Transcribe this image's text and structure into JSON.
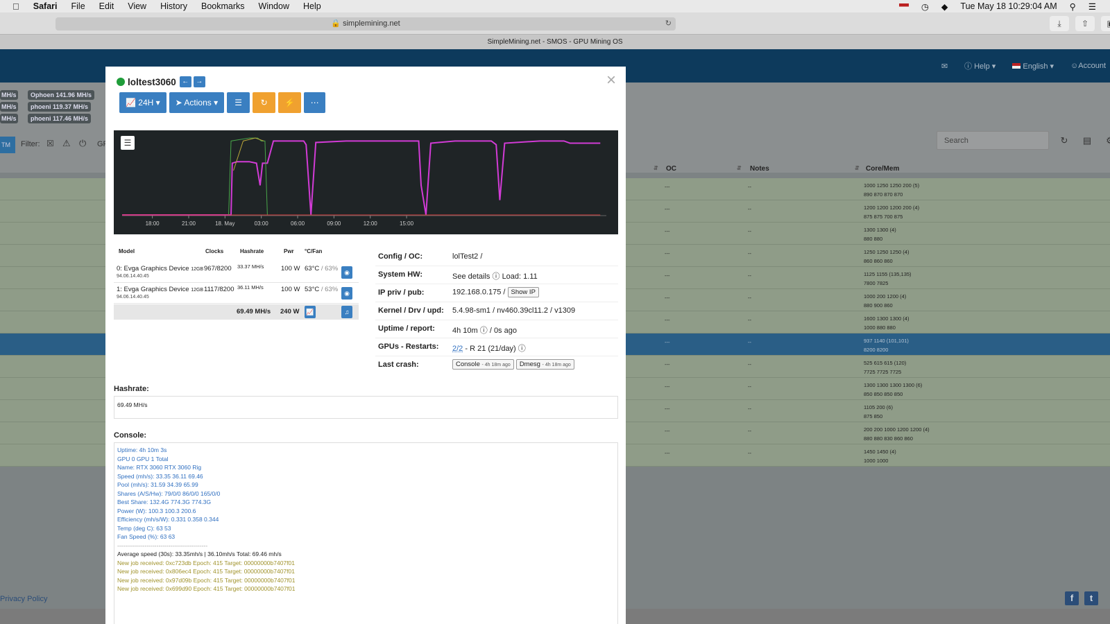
{
  "menubar": {
    "app": "Safari",
    "items": [
      "File",
      "Edit",
      "View",
      "History",
      "Bookmarks",
      "Window",
      "Help"
    ],
    "clock": "Tue May 18  10:29:04 AM"
  },
  "browser": {
    "url": "simplemining.net",
    "tab_title": "SimpleMining.net - SMOS - GPU Mining OS"
  },
  "navbar": {
    "help": "Help",
    "language": "English",
    "account": "Account"
  },
  "background": {
    "coins": [
      "Ophoen 141.96 MH/s",
      "phoeni 119.37 MH/s",
      "phoeni 117.46 MH/s"
    ],
    "left_stubs": [
      "MH/s",
      "MH/s",
      "MH/s"
    ],
    "filter_label": "Filter:",
    "filter_tag": "TM",
    "filter_extra": "GP",
    "search_placeholder": "Search",
    "headers": {
      "oc": "OC",
      "notes": "Notes",
      "core": "Core/Mem"
    },
    "rows": [
      {
        "oc": "---",
        "notes": "--",
        "core1": "1000 1250 1250 200 (5)",
        "core2": "890 870 870 870"
      },
      {
        "oc": "---",
        "notes": "--",
        "core1": "1200 1200 1200 200 (4)",
        "core2": "875 875 700 875"
      },
      {
        "oc": "---",
        "notes": "--",
        "core1": "1300 1300 (4)",
        "core2": "880 880"
      },
      {
        "oc": "---",
        "notes": "--",
        "core1": "1250 1250 1250 (4)",
        "core2": "860 860 860"
      },
      {
        "oc": "---",
        "notes": "--",
        "core1": "1125 1155 (135,135)",
        "core2": "7800 7825"
      },
      {
        "oc": "---",
        "notes": "--",
        "core1": "1000 200 1200 (4)",
        "core2": "880 900 860"
      },
      {
        "oc": "---",
        "notes": "--",
        "core1": "1600 1300 1300 (4)",
        "core2": "1000 880 880"
      },
      {
        "oc": "---",
        "notes": "--",
        "core1": "937 1140 (101,101)",
        "core2": "8200 8200"
      },
      {
        "oc": "---",
        "notes": "--",
        "core1": "525 615 615 (120)",
        "core2": "7725 7725 7725"
      },
      {
        "oc": "---",
        "notes": "--",
        "core1": "1300 1300 1300 1300 (6)",
        "core2": "850 850 850 850"
      },
      {
        "oc": "---",
        "notes": "--",
        "core1": "1105 200 (6)",
        "core2": "875 850"
      },
      {
        "oc": "---",
        "notes": "--",
        "core1": "200 200 1000 1200 1200 (4)",
        "core2": "880 880 830 860 860"
      },
      {
        "oc": "---",
        "notes": "--",
        "core1": "1450 1450 (4)",
        "core2": "1000 1000"
      }
    ],
    "privacy": "Privacy Policy"
  },
  "modal": {
    "rig_name": "loltest3060",
    "buttons": {
      "period": "24H",
      "actions": "Actions"
    },
    "chart_data": {
      "type": "line",
      "x_ticks": [
        "18:00",
        "21:00",
        "18. May",
        "03:00",
        "06:00",
        "09:00",
        "12:00",
        "15:00"
      ],
      "series": [
        {
          "color": "#d23bd6",
          "points": [
            [
              16.5,
              0
            ],
            [
              19,
              0
            ],
            [
              21,
              0
            ],
            [
              23,
              0
            ],
            [
              25.5,
              0
            ],
            [
              25.6,
              70
            ],
            [
              26,
              72
            ],
            [
              27,
              72
            ],
            [
              27.6,
              70
            ],
            [
              27.9,
              40
            ],
            [
              28.1,
              70
            ],
            [
              28.5,
              70
            ],
            [
              29,
              100
            ],
            [
              31.5,
              100
            ],
            [
              31.7,
              95
            ],
            [
              32.1,
              0
            ],
            [
              32.5,
              98
            ],
            [
              35,
              100
            ],
            [
              38,
              100
            ],
            [
              41,
              100
            ],
            [
              41.2,
              40
            ],
            [
              41.6,
              0
            ],
            [
              42,
              97
            ],
            [
              44,
              100
            ],
            [
              47,
              100
            ],
            [
              47.4,
              95
            ],
            [
              47.7,
              20
            ],
            [
              48.1,
              97
            ],
            [
              51,
              100
            ],
            [
              53,
              100
            ],
            [
              53.5,
              97
            ],
            [
              56,
              97
            ]
          ]
        },
        {
          "color": "#49a64a",
          "points": [
            [
              25.3,
              0
            ],
            [
              25.5,
              100
            ],
            [
              27,
              104
            ],
            [
              27.7,
              104
            ],
            [
              28,
              100
            ],
            [
              28.3,
              100
            ],
            [
              28.5,
              0
            ]
          ]
        },
        {
          "color": "#b9a63a",
          "points": [
            [
              25.7,
              60
            ],
            [
              26.5,
              100
            ],
            [
              27.5,
              104
            ],
            [
              28.2,
              100
            ]
          ]
        },
        {
          "color": "#d23b3b",
          "points": [
            [
              16.5,
              0
            ],
            [
              56,
              0
            ]
          ]
        }
      ],
      "ylim": [
        0,
        105
      ],
      "xlim": [
        16.5,
        56.5
      ]
    },
    "gpu_table": {
      "headers": {
        "model": "Model",
        "clocks": "Clocks",
        "hashrate": "Hashrate",
        "pwr": "Pwr",
        "temp": "°C/Fan"
      },
      "rows": [
        {
          "model": "0: Evga Graphics Device",
          "mem": "12GB",
          "ver": "94.06.14.40.45",
          "clocks": "967/8200",
          "hashrate": "33.37 MH/s",
          "pwr": "100 W",
          "temp": "63°C",
          "fan": "/ 63%"
        },
        {
          "model": "1: Evga Graphics Device",
          "mem": "12GB",
          "ver": "94.06.14.40.45",
          "clocks": "1117/8200",
          "hashrate": "36.11 MH/s",
          "pwr": "100 W",
          "temp": "53°C",
          "fan": "/ 63%"
        }
      ],
      "total_hashrate": "69.49 MH/s",
      "total_pwr": "240 W"
    },
    "info": {
      "config_label": "Config / OC:",
      "config_val": "lolTest2 /",
      "hw_label": "System HW:",
      "hw_link": "See details",
      "hw_load": "Load: 1.11",
      "ip_label": "IP priv / pub:",
      "ip_val": "192.168.0.175 /",
      "show_ip": "Show IP",
      "kernel_label": "Kernel / Drv / upd:",
      "kernel_val": "5.4.98-sm1 / nv460.39cl11.2 / v1309",
      "uptime_label": "Uptime / report:",
      "uptime_val": "4h 10m",
      "report_val": "/ 0s ago",
      "gpus_label": "GPUs - Restarts:",
      "gpus_link": "2/2",
      "gpus_val": "- R 21 (21/day)",
      "crash_label": "Last crash:",
      "console_btn": "Console",
      "console_ago": "- 4h 18m ago",
      "dmesg_btn": "Dmesg",
      "dmesg_ago": "- 4h 18m ago"
    },
    "hashrate_label": "Hashrate:",
    "hashrate_value": "69.49 MH/s",
    "console_label": "Console:",
    "console_blue": [
      "Uptime: 4h 10m 3s",
      "GPU 0 GPU 1 Total",
      "Name: RTX 3060 RTX 3060 Rig",
      "Speed (mh/s): 33.35 36.11 69.46",
      "Pool (mh/s): 31.59 34.39 65.99",
      "Shares (A/S/Hw): 79/0/0 86/0/0 165/0/0",
      "Best Share: 132.4G 774.3G 774.3G",
      "Power (W): 100.3 100.3 200.6",
      "Efficiency (mh/s/W): 0.331 0.358 0.344",
      "Temp (deg C): 63 53",
      "Fan Speed (%): 63 63"
    ],
    "console_divider": "------------------------------------------------------------------------",
    "console_avg": "Average speed (30s): 33.35mh/s | 36.10mh/s Total: 69.46 mh/s",
    "console_jobs": [
      "New job received: 0xc723db Epoch: 415 Target: 00000000b7407f01",
      "New job received: 0x806ec4 Epoch: 415 Target: 00000000b7407f01",
      "New job received: 0x97d09b Epoch: 415 Target: 00000000b7407f01",
      "New job received: 0x699d90 Epoch: 415 Target: 00000000b7407f01"
    ]
  }
}
